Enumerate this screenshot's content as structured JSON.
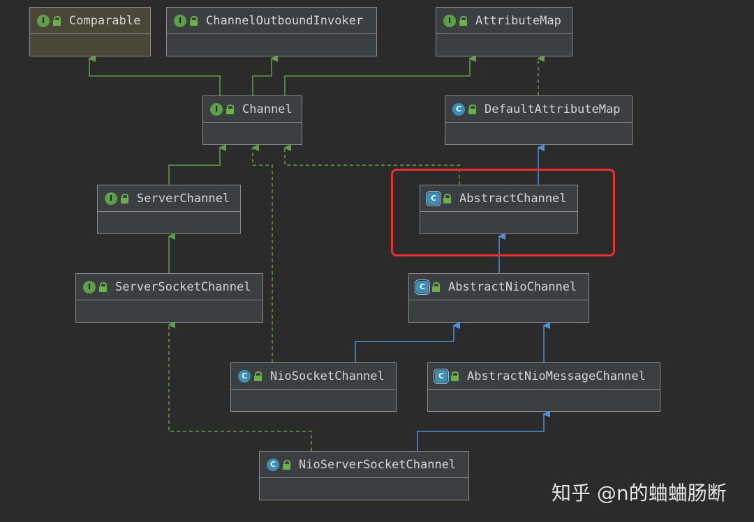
{
  "nodes": {
    "comparable": {
      "label": "Comparable",
      "kind": "I"
    },
    "outbound": {
      "label": "ChannelOutboundInvoker",
      "kind": "I"
    },
    "attributemap": {
      "label": "AttributeMap",
      "kind": "I"
    },
    "channel": {
      "label": "Channel",
      "kind": "I"
    },
    "defaultattributemap": {
      "label": "DefaultAttributeMap",
      "kind": "C"
    },
    "serverchannel": {
      "label": "ServerChannel",
      "kind": "I"
    },
    "abstractchannel": {
      "label": "AbstractChannel",
      "kind": "C"
    },
    "serversocketchannel": {
      "label": "ServerSocketChannel",
      "kind": "I"
    },
    "abstractniochannel": {
      "label": "AbstractNioChannel",
      "kind": "C"
    },
    "niosocketchannel": {
      "label": "NioSocketChannel",
      "kind": "C"
    },
    "abstractniomessagechannel": {
      "label": "AbstractNioMessageChannel",
      "kind": "C"
    },
    "nioserversocketchannel": {
      "label": "NioServerSocketChannel",
      "kind": "C"
    }
  },
  "badge_letters": {
    "interface": "I",
    "class": "C"
  },
  "watermark": "知乎 @n的蛐蛐肠断",
  "colors": {
    "background": "#2b2b2b",
    "extends_interface": "#5f9f45",
    "extends_class": "#4f8fe0",
    "highlight": "#e8302d"
  }
}
